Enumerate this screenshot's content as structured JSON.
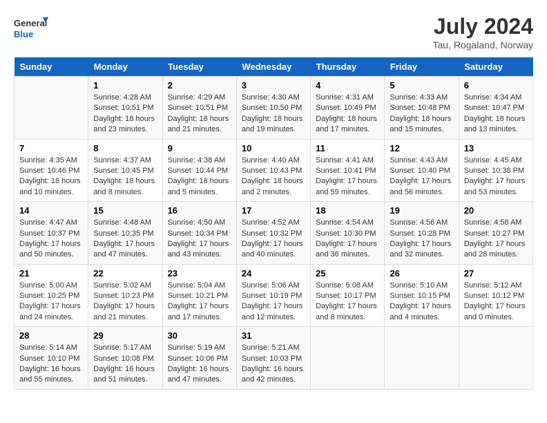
{
  "header": {
    "logo_line1": "General",
    "logo_line2": "Blue",
    "month": "July 2024",
    "location": "Tau, Rogaland, Norway"
  },
  "days_of_week": [
    "Sunday",
    "Monday",
    "Tuesday",
    "Wednesday",
    "Thursday",
    "Friday",
    "Saturday"
  ],
  "weeks": [
    [
      {
        "day": "",
        "info": ""
      },
      {
        "day": "1",
        "info": "Sunrise: 4:28 AM\nSunset: 10:51 PM\nDaylight: 18 hours\nand 23 minutes."
      },
      {
        "day": "2",
        "info": "Sunrise: 4:29 AM\nSunset: 10:51 PM\nDaylight: 18 hours\nand 21 minutes."
      },
      {
        "day": "3",
        "info": "Sunrise: 4:30 AM\nSunset: 10:50 PM\nDaylight: 18 hours\nand 19 minutes."
      },
      {
        "day": "4",
        "info": "Sunrise: 4:31 AM\nSunset: 10:49 PM\nDaylight: 18 hours\nand 17 minutes."
      },
      {
        "day": "5",
        "info": "Sunrise: 4:33 AM\nSunset: 10:48 PM\nDaylight: 18 hours\nand 15 minutes."
      },
      {
        "day": "6",
        "info": "Sunrise: 4:34 AM\nSunset: 10:47 PM\nDaylight: 18 hours\nand 13 minutes."
      }
    ],
    [
      {
        "day": "7",
        "info": "Sunrise: 4:35 AM\nSunset: 10:46 PM\nDaylight: 18 hours\nand 10 minutes."
      },
      {
        "day": "8",
        "info": "Sunrise: 4:37 AM\nSunset: 10:45 PM\nDaylight: 18 hours\nand 8 minutes."
      },
      {
        "day": "9",
        "info": "Sunrise: 4:38 AM\nSunset: 10:44 PM\nDaylight: 18 hours\nand 5 minutes."
      },
      {
        "day": "10",
        "info": "Sunrise: 4:40 AM\nSunset: 10:43 PM\nDaylight: 18 hours\nand 2 minutes."
      },
      {
        "day": "11",
        "info": "Sunrise: 4:41 AM\nSunset: 10:41 PM\nDaylight: 17 hours\nand 59 minutes."
      },
      {
        "day": "12",
        "info": "Sunrise: 4:43 AM\nSunset: 10:40 PM\nDaylight: 17 hours\nand 56 minutes."
      },
      {
        "day": "13",
        "info": "Sunrise: 4:45 AM\nSunset: 10:38 PM\nDaylight: 17 hours\nand 53 minutes."
      }
    ],
    [
      {
        "day": "14",
        "info": "Sunrise: 4:47 AM\nSunset: 10:37 PM\nDaylight: 17 hours\nand 50 minutes."
      },
      {
        "day": "15",
        "info": "Sunrise: 4:48 AM\nSunset: 10:35 PM\nDaylight: 17 hours\nand 47 minutes."
      },
      {
        "day": "16",
        "info": "Sunrise: 4:50 AM\nSunset: 10:34 PM\nDaylight: 17 hours\nand 43 minutes."
      },
      {
        "day": "17",
        "info": "Sunrise: 4:52 AM\nSunset: 10:32 PM\nDaylight: 17 hours\nand 40 minutes."
      },
      {
        "day": "18",
        "info": "Sunrise: 4:54 AM\nSunset: 10:30 PM\nDaylight: 17 hours\nand 36 minutes."
      },
      {
        "day": "19",
        "info": "Sunrise: 4:56 AM\nSunset: 10:28 PM\nDaylight: 17 hours\nand 32 minutes."
      },
      {
        "day": "20",
        "info": "Sunrise: 4:58 AM\nSunset: 10:27 PM\nDaylight: 17 hours\nand 28 minutes."
      }
    ],
    [
      {
        "day": "21",
        "info": "Sunrise: 5:00 AM\nSunset: 10:25 PM\nDaylight: 17 hours\nand 24 minutes."
      },
      {
        "day": "22",
        "info": "Sunrise: 5:02 AM\nSunset: 10:23 PM\nDaylight: 17 hours\nand 21 minutes."
      },
      {
        "day": "23",
        "info": "Sunrise: 5:04 AM\nSunset: 10:21 PM\nDaylight: 17 hours\nand 17 minutes."
      },
      {
        "day": "24",
        "info": "Sunrise: 5:06 AM\nSunset: 10:19 PM\nDaylight: 17 hours\nand 12 minutes."
      },
      {
        "day": "25",
        "info": "Sunrise: 5:08 AM\nSunset: 10:17 PM\nDaylight: 17 hours\nand 8 minutes."
      },
      {
        "day": "26",
        "info": "Sunrise: 5:10 AM\nSunset: 10:15 PM\nDaylight: 17 hours\nand 4 minutes."
      },
      {
        "day": "27",
        "info": "Sunrise: 5:12 AM\nSunset: 10:12 PM\nDaylight: 17 hours\nand 0 minutes."
      }
    ],
    [
      {
        "day": "28",
        "info": "Sunrise: 5:14 AM\nSunset: 10:10 PM\nDaylight: 16 hours\nand 55 minutes."
      },
      {
        "day": "29",
        "info": "Sunrise: 5:17 AM\nSunset: 10:08 PM\nDaylight: 16 hours\nand 51 minutes."
      },
      {
        "day": "30",
        "info": "Sunrise: 5:19 AM\nSunset: 10:06 PM\nDaylight: 16 hours\nand 47 minutes."
      },
      {
        "day": "31",
        "info": "Sunrise: 5:21 AM\nSunset: 10:03 PM\nDaylight: 16 hours\nand 42 minutes."
      },
      {
        "day": "",
        "info": ""
      },
      {
        "day": "",
        "info": ""
      },
      {
        "day": "",
        "info": ""
      }
    ]
  ]
}
